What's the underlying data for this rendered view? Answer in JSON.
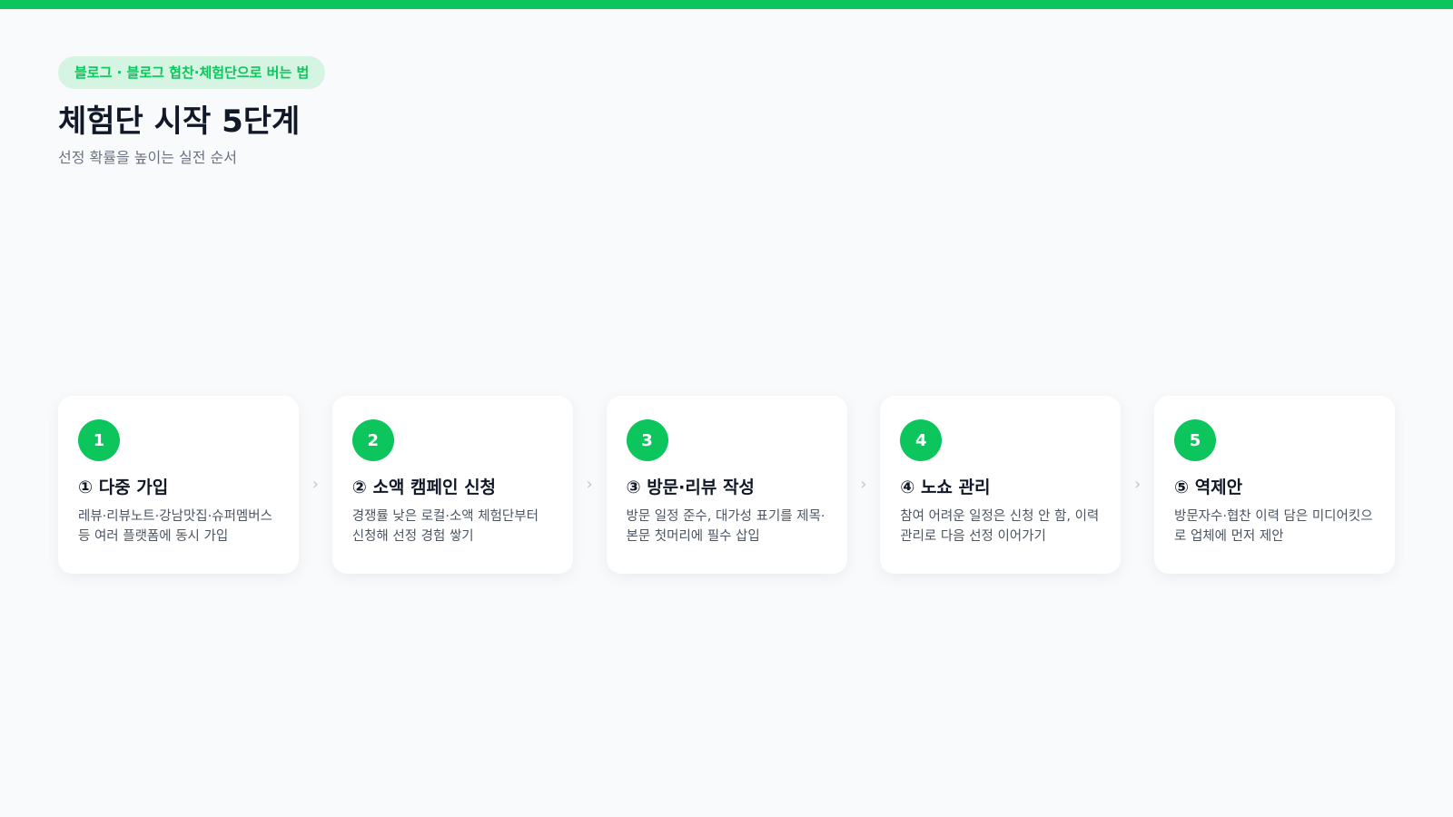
{
  "header": {
    "tag": "블로그 · 블로그 협찬·체험단으로 버는 법",
    "title": "체험단 시작 5단계",
    "subtitle": "선정 확률을 높이는 실전 순서"
  },
  "steps": [
    {
      "number": "1",
      "title": "① 다중 가입",
      "description": "레뷰·리뷰노트·강남맛집·슈퍼멤버스 등 여러 플랫폼에 동시 가입"
    },
    {
      "number": "2",
      "title": "② 소액 캠페인 신청",
      "description": "경쟁률 낮은 로컬·소액 체험단부터 신청해 선정 경험 쌓기"
    },
    {
      "number": "3",
      "title": "③ 방문·리뷰 작성",
      "description": "방문 일정 준수, 대가성 표기를 제목·본문 첫머리에 필수 삽입"
    },
    {
      "number": "4",
      "title": "④ 노쇼 관리",
      "description": "참여 어려운 일정은 신청 안 함, 이력 관리로 다음 선정 이어가기"
    },
    {
      "number": "5",
      "title": "⑤ 역제안",
      "description": "방문자수·협찬 이력 담은 미디어킷으로 업체에 먼저 제안"
    }
  ],
  "arrow_glyph": "›",
  "colors": {
    "accent": "#0cc55c",
    "tag_bg": "#d6f4e2",
    "background": "#f8fafc"
  }
}
